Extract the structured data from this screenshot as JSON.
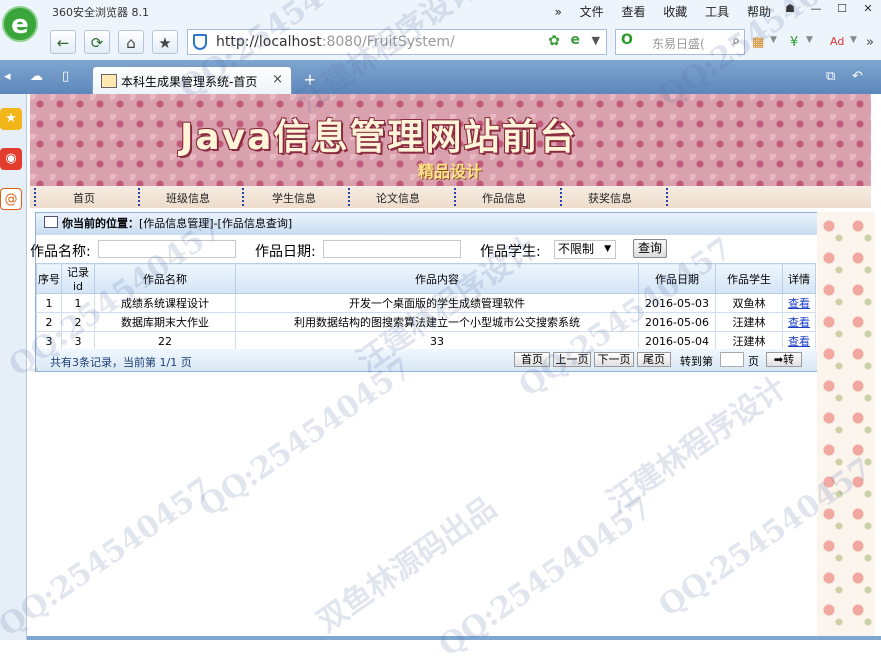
{
  "browser": {
    "app_title": "360安全浏览器 8.1",
    "top_menu": [
      "»",
      "文件",
      "查看",
      "收藏",
      "工具",
      "帮助"
    ],
    "url_host": "http://localhost",
    "url_rest": ":8080/FruitSystem/",
    "search_placeholder": "东易日盛(",
    "tab_title": "本科生成果管理系统-首页",
    "tab_close": "×",
    "tab_plus": "+"
  },
  "site": {
    "banner_title": "Java信息管理网站前台",
    "banner_subtitle": "精品设计",
    "menu": [
      "首页",
      "班级信息",
      "学生信息",
      "论文信息",
      "作品信息",
      "获奖信息"
    ]
  },
  "location": {
    "label": "你当前的位置：",
    "path": "[作品信息管理]-[作品信息查询]"
  },
  "filter": {
    "name_label": "作品名称:",
    "date_label": "作品日期:",
    "student_label": "作品学生:",
    "student_value": "不限制",
    "query_button": "查询"
  },
  "table": {
    "headers": [
      "序号",
      "记录id",
      "作品名称",
      "作品内容",
      "作品日期",
      "作品学生",
      "详情"
    ],
    "rows": [
      {
        "no": "1",
        "id": "1",
        "name": "成绩系统课程设计",
        "content": "开发一个桌面版的学生成绩管理软件",
        "date": "2016-05-03",
        "student": "双鱼林",
        "detail": "查看"
      },
      {
        "no": "2",
        "id": "2",
        "name": "数据库期末大作业",
        "content": "利用数据结构的图搜索算法建立一个小型城市公交搜索系统",
        "date": "2016-05-06",
        "student": "汪建林",
        "detail": "查看"
      },
      {
        "no": "3",
        "id": "3",
        "name": "22",
        "content": "33",
        "date": "2016-05-04",
        "student": "汪建林",
        "detail": "查看"
      }
    ]
  },
  "pager": {
    "info": "共有3条记录，当前第 1/1 页",
    "first": "首页",
    "prev": "上一页",
    "next": "下一页",
    "last": "尾页",
    "goto_label": "转到第",
    "page_suffix": "页",
    "go_button": "➡转"
  },
  "watermarks": [
    "QQ:254540457",
    "双鱼林源码出品",
    "汪建林程序设计"
  ]
}
